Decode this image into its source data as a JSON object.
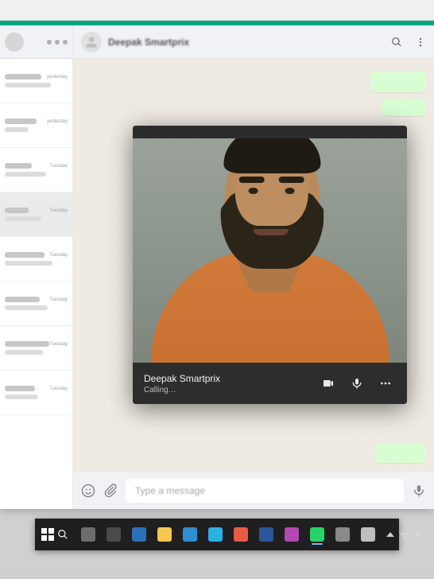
{
  "app": {
    "contact_name": "Deepak Smartprix",
    "compose_placeholder": "Type a message"
  },
  "sidebar": {
    "items": [
      {
        "time": "yesterday",
        "namew": 46,
        "msgw": 58
      },
      {
        "time": "yesterday",
        "namew": 40,
        "msgw": 30
      },
      {
        "time": "Tuesday",
        "namew": 34,
        "msgw": 52
      },
      {
        "time": "Tuesday",
        "namew": 30,
        "msgw": 46
      },
      {
        "time": "Tuesday",
        "namew": 50,
        "msgw": 60
      },
      {
        "time": "Tuesday",
        "namew": 44,
        "msgw": 54
      },
      {
        "time": "Tuesday",
        "namew": 56,
        "msgw": 48
      },
      {
        "time": "Tuesday",
        "namew": 38,
        "msgw": 42
      }
    ],
    "active_index": 3
  },
  "call": {
    "name": "Deepak Smartprix",
    "status": "Calling…"
  },
  "taskbar": {
    "icons": [
      {
        "name": "task-view-icon",
        "color": "#6d6d6d"
      },
      {
        "name": "cortana-icon",
        "color": "#4a4a4a"
      },
      {
        "name": "mail-icon",
        "color": "#2c6fbb"
      },
      {
        "name": "explorer-icon",
        "color": "#f5c752"
      },
      {
        "name": "edge-icon",
        "color": "#2f8fd0"
      },
      {
        "name": "store-icon",
        "color": "#2bb0e4"
      },
      {
        "name": "chrome-icon",
        "color": "#e85b45"
      },
      {
        "name": "word-icon",
        "color": "#2b579a"
      },
      {
        "name": "photos-icon",
        "color": "#b348b3"
      },
      {
        "name": "whatsapp-icon",
        "color": "#25d366"
      },
      {
        "name": "app-11-icon",
        "color": "#8a8a8a"
      },
      {
        "name": "app-12-icon",
        "color": "#bfbfbf"
      }
    ]
  }
}
